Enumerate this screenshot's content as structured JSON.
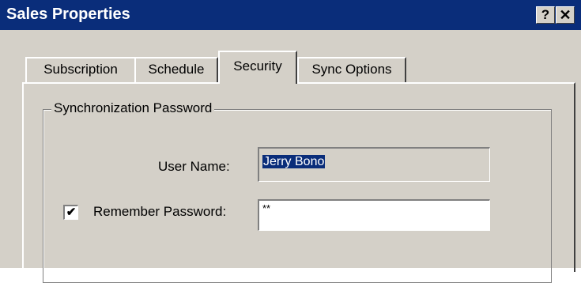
{
  "window": {
    "title": "Sales Properties"
  },
  "titlebar": {
    "help_label": "?",
    "close_label": "✕"
  },
  "tabs": [
    {
      "label": "Subscription"
    },
    {
      "label": "Schedule"
    },
    {
      "label": "Security",
      "active": true
    },
    {
      "label": "Sync Options"
    }
  ],
  "group": {
    "title": "Synchronization Password",
    "username_label": "User Name:",
    "username_value": "Jerry Bono",
    "remember_label": "Remember Password:",
    "remember_checked": true,
    "password_value": "**"
  },
  "checkbox_mark": "✔"
}
